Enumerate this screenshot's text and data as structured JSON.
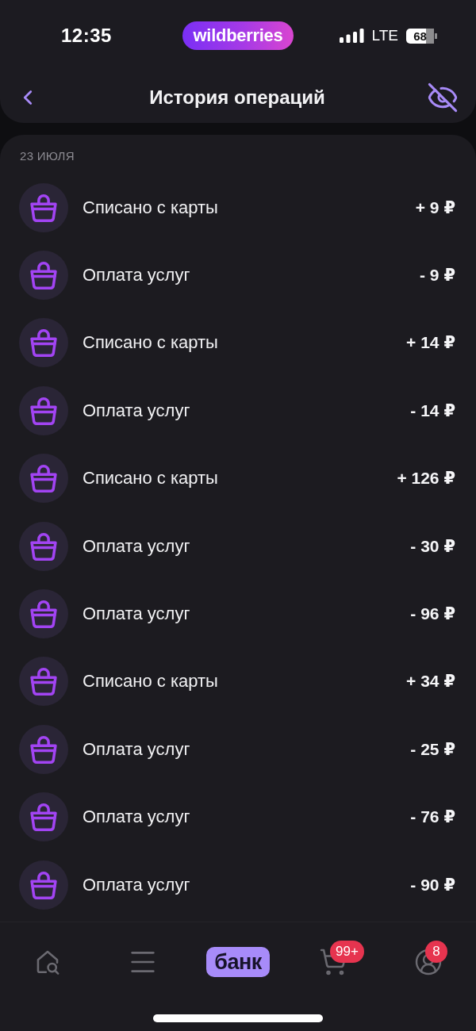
{
  "status_bar": {
    "time": "12:35",
    "logo": "wildberries",
    "network": "LTE",
    "battery": "68"
  },
  "header": {
    "title": "История операций"
  },
  "operations": {
    "date": "23 ИЮЛЯ",
    "items": [
      {
        "title": "Списано с карты",
        "amount": "+ 9 ₽"
      },
      {
        "title": "Оплата услуг",
        "amount": "- 9 ₽"
      },
      {
        "title": "Списано с карты",
        "amount": "+ 14 ₽"
      },
      {
        "title": "Оплата услуг",
        "amount": "- 14 ₽"
      },
      {
        "title": "Списано с карты",
        "amount": "+ 126 ₽"
      },
      {
        "title": "Оплата услуг",
        "amount": "- 30 ₽"
      },
      {
        "title": "Оплата услуг",
        "amount": "- 96 ₽"
      },
      {
        "title": "Списано с карты",
        "amount": "+ 34 ₽"
      },
      {
        "title": "Оплата услуг",
        "amount": "- 25 ₽"
      },
      {
        "title": "Оплата услуг",
        "amount": "- 76 ₽"
      },
      {
        "title": "Оплата услуг",
        "amount": "- 90 ₽"
      }
    ]
  },
  "tab_bar": {
    "tabs": [
      {
        "kind": "search",
        "selected": false
      },
      {
        "kind": "menu",
        "selected": false
      },
      {
        "kind": "label",
        "label": "банк",
        "selected": true
      },
      {
        "kind": "cart",
        "badge": "99+",
        "selected": false
      },
      {
        "kind": "profile",
        "badge": "8",
        "selected": false
      }
    ]
  }
}
